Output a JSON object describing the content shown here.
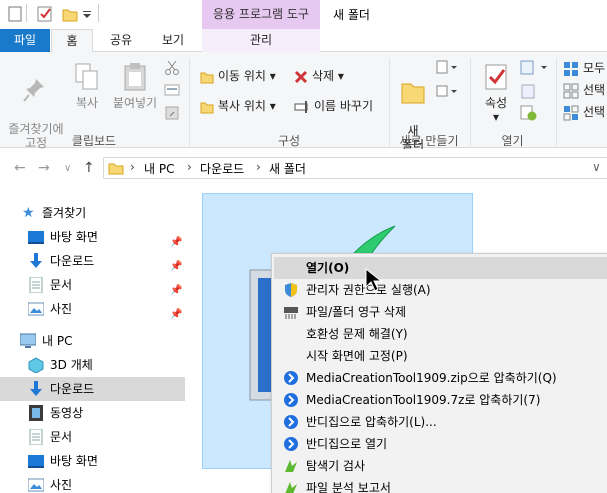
{
  "titlebar": {
    "context_group_label": "응용 프로그램 도구",
    "window_title": "새 폴더"
  },
  "tabs": {
    "file": "파일",
    "home": "홈",
    "share": "공유",
    "view": "보기",
    "manage": "관리"
  },
  "ribbon": {
    "clipboard": {
      "pin_quick_access": "즐겨찾기에\n고정",
      "copy": "복사",
      "paste": "붙여넣기",
      "group_label": "클립보드"
    },
    "organize": {
      "move_to": "이동 위치",
      "delete": "삭제",
      "copy_to": "복사 위치",
      "rename": "이름 바꾸기",
      "group_label": "구성"
    },
    "new": {
      "new_folder": "새\n폴더",
      "group_label": "새로 만들기"
    },
    "open": {
      "properties": "속성",
      "group_label": "열기"
    },
    "select": {
      "select_all": "모두",
      "select_none": "선택",
      "invert_selection": "선택"
    }
  },
  "address": {
    "crumbs": [
      "내 PC",
      "다운로드",
      "새 폴더"
    ]
  },
  "navpane": {
    "quick_access": "즐겨찾기",
    "items": [
      {
        "label": "바탕 화면"
      },
      {
        "label": "다운로드"
      },
      {
        "label": "문서"
      },
      {
        "label": "사진"
      }
    ],
    "this_pc": "내 PC",
    "pc_items": [
      {
        "label": "3D 개체"
      },
      {
        "label": "다운로드"
      },
      {
        "label": "동영상"
      },
      {
        "label": "문서"
      },
      {
        "label": "바탕 화면"
      },
      {
        "label": "사진"
      }
    ]
  },
  "context_menu": {
    "items": [
      {
        "label": "열기(O)"
      },
      {
        "label": "관리자 권한으로 실행(A)"
      },
      {
        "label": "파일/폴더 영구 삭제"
      },
      {
        "label": "호환성 문제 해결(Y)"
      },
      {
        "label": "시작 화면에 고정(P)"
      },
      {
        "label": "MediaCreationTool1909.zip으로 압축하기(Q)"
      },
      {
        "label": "MediaCreationTool1909.7z로 압축하기(7)"
      },
      {
        "label": "반디집으로 압축하기(L)..."
      },
      {
        "label": "반디집으로 열기"
      },
      {
        "label": "탐색기 검사"
      },
      {
        "label": "파일 분석 보고서"
      }
    ]
  },
  "colors": {
    "file_tab": "#1979ca",
    "context_tab": "#e6c8f0",
    "selection": "#cce8ff",
    "menu_highlight": "#d9d9d9"
  }
}
